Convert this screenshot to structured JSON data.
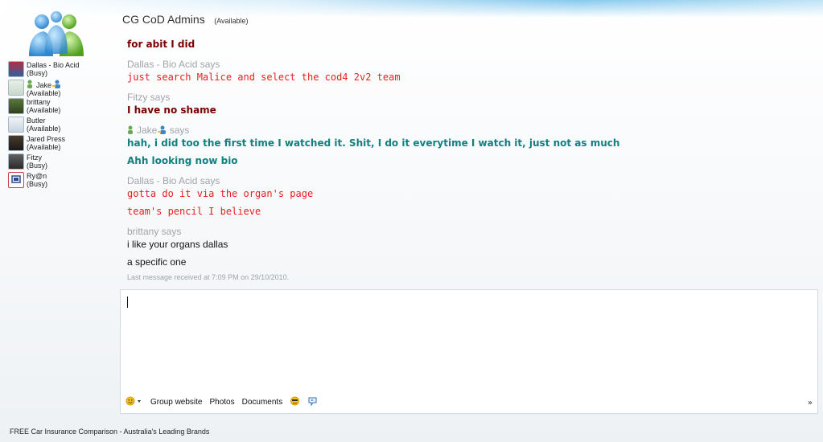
{
  "header": {
    "title": "CG CoD Admins",
    "status": "(Available)"
  },
  "contacts": [
    {
      "name": "Dallas - Bio Acid",
      "status": "(Busy)"
    },
    {
      "name": "Jake",
      "status": "(Available)"
    },
    {
      "name": "brittany",
      "status": "(Available)"
    },
    {
      "name": "Butler",
      "status": "(Available)"
    },
    {
      "name": "Jared Press",
      "status": "(Available)"
    },
    {
      "name": "Fitzy",
      "status": "(Busy)"
    },
    {
      "name": "Ry@n",
      "status": "(Busy)"
    }
  ],
  "conversation": {
    "first_message": "for abit I did",
    "blocks": [
      {
        "sender": "Dallas - Bio Acid says",
        "messages": [
          "just search Malice and select the cod4 2v2 team"
        ]
      },
      {
        "sender": "Fitzy says",
        "messages": [
          "I have no shame"
        ]
      },
      {
        "sender_name": "Jake",
        "sender_suffix": "says",
        "messages": [
          "hah, i did too the first time I watched it. Shit, I do it everytime I watch it, just not as much",
          "Ahh looking now bio"
        ]
      },
      {
        "sender": "Dallas - Bio Acid says",
        "messages": [
          "gotta do it via the organ's page",
          "team's pencil I believe"
        ]
      },
      {
        "sender": "brittany says",
        "messages": [
          "i like your organs dallas",
          "a specific one"
        ]
      }
    ],
    "last_received": "Last message received at 7:09 PM on 29/10/2010."
  },
  "toolbar": {
    "emoticon_icon": "smiley-icon",
    "group_website": "Group website",
    "photos": "Photos",
    "documents": "Documents",
    "more": "»"
  },
  "footer": {
    "ad": "FREE Car Insurance Comparison - Australia's Leading Brands"
  },
  "colors": {
    "maroon": "#7a0000",
    "red": "#e82020",
    "teal": "#108080",
    "sender_gray": "#a0a4a8"
  }
}
